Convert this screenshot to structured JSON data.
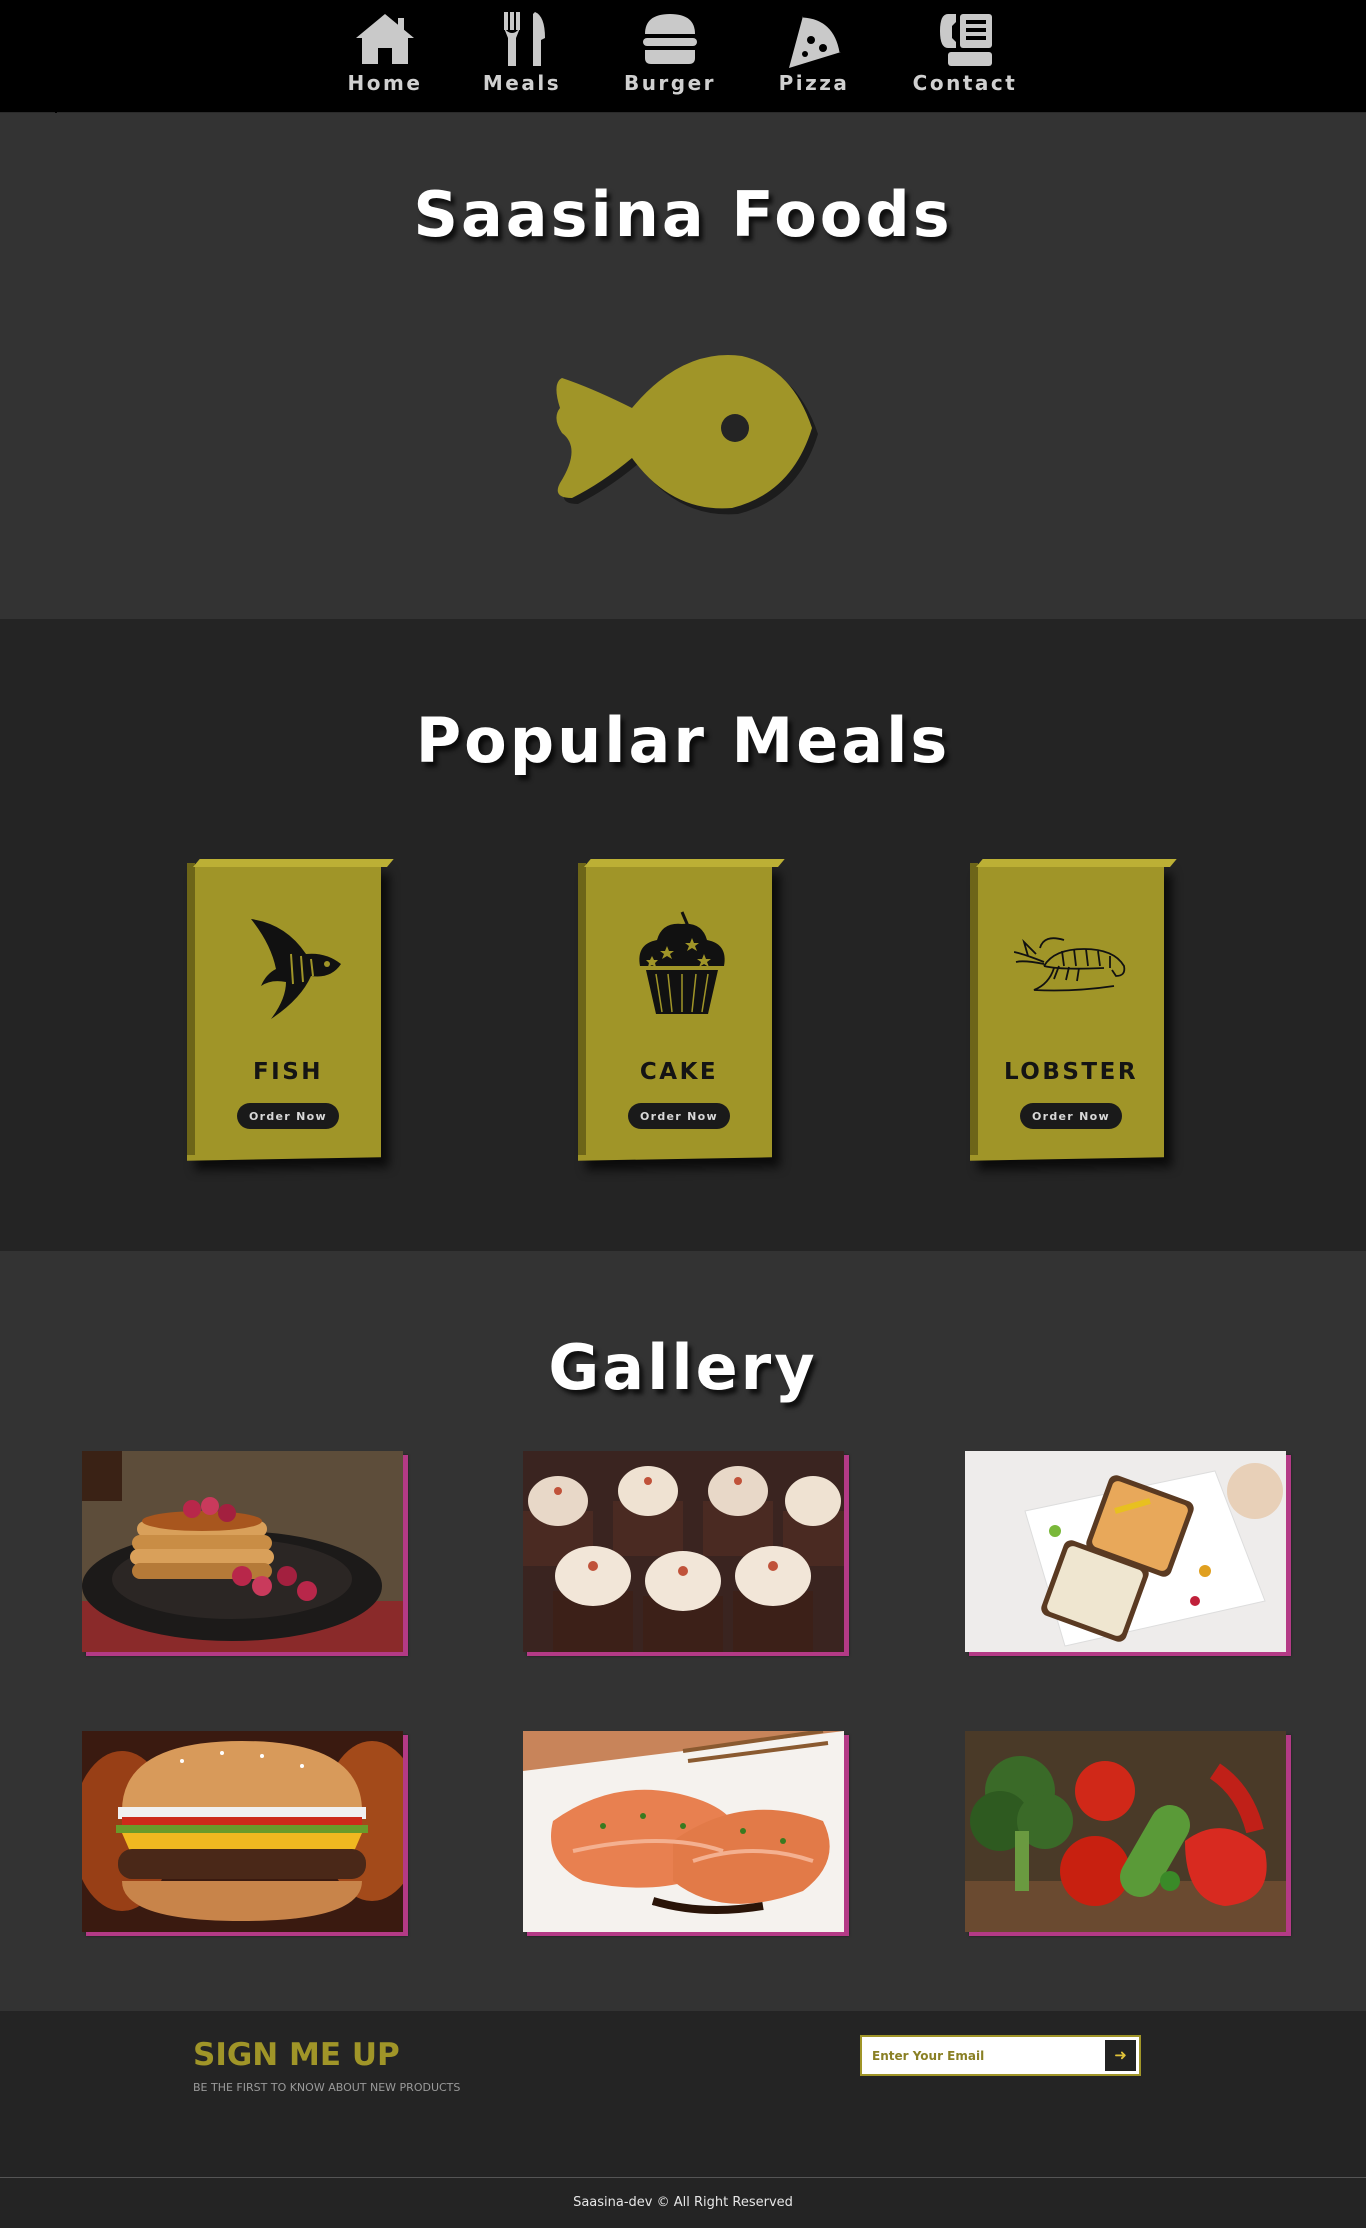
{
  "nav": {
    "items": [
      {
        "label": "Home",
        "icon": "home-icon"
      },
      {
        "label": "Meals",
        "icon": "utensils-icon"
      },
      {
        "label": "Burger",
        "icon": "burger-icon"
      },
      {
        "label": "Pizza",
        "icon": "pizza-icon"
      },
      {
        "label": "Contact",
        "icon": "phone-icon"
      }
    ]
  },
  "hero": {
    "title": "Saasina Foods",
    "icon": "fish-icon"
  },
  "meals": {
    "title": "Popular Meals",
    "cards": [
      {
        "name": "FISH",
        "button": "Order Now",
        "icon": "angelfish-icon"
      },
      {
        "name": "CAKE",
        "button": "Order Now",
        "icon": "cupcake-icon"
      },
      {
        "name": "LOBSTER",
        "button": "Order Now",
        "icon": "shrimp-icon"
      }
    ]
  },
  "gallery": {
    "title": "Gallery",
    "images": [
      "pancakes-image",
      "cupcakes-image",
      "toast-image",
      "burger-image",
      "salmon-image",
      "vegetables-image"
    ]
  },
  "signup": {
    "title": "SIGN ME UP",
    "subtitle": "BE THE FIRST TO KNOW ABOUT NEW PRODUCTS",
    "email_placeholder": "Enter Your Email",
    "submit_icon": "arrow-right-icon"
  },
  "footer": {
    "copyright": "Saasina-dev © All Right Reserved"
  },
  "colors": {
    "accent": "#a09528",
    "dark": "#242424",
    "mid": "#333333",
    "nav": "#000000"
  }
}
